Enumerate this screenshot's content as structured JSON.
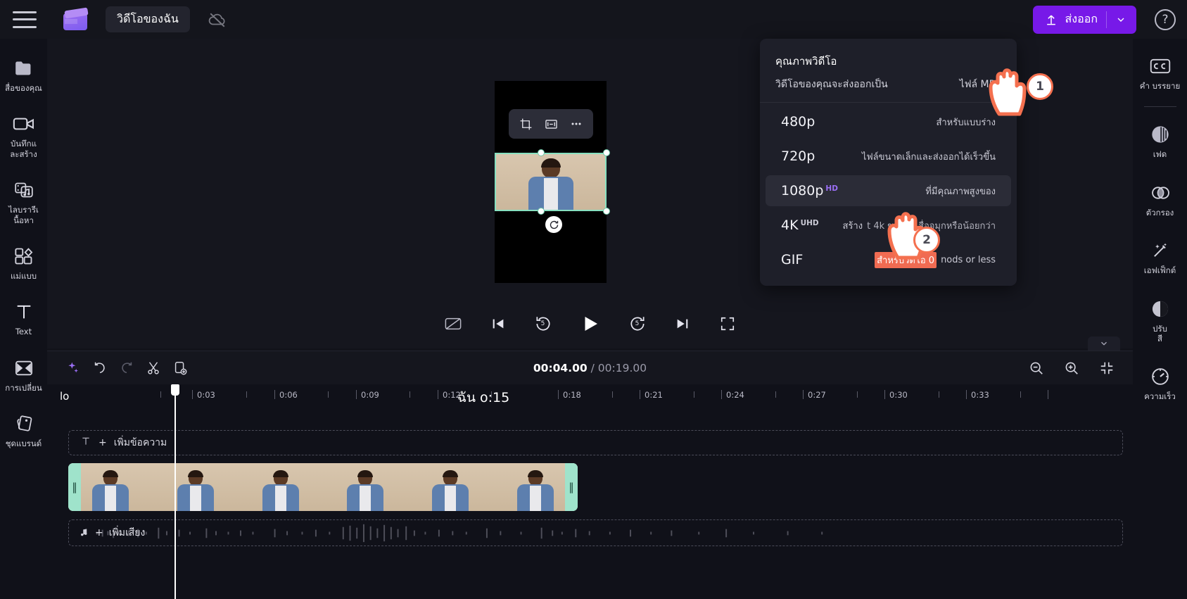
{
  "app": {
    "project_name": "วิดีโอของฉัน",
    "menu_icon": "hamburger-icon",
    "logo_icon": "clapperboard-logo",
    "cloud_icon": "cloud-offline-icon",
    "help_icon": "help-question-icon",
    "export_label": "ส่งออก",
    "export_color": "#7719e8",
    "accent_color": "#9b6ff5",
    "highlight_color": "#f06b52"
  },
  "left_sidebar": {
    "items": [
      {
        "icon": "folder-icon",
        "label": "สื่อของคุณ"
      },
      {
        "icon": "video-camera-icon",
        "label": "บันทึกแ\nละสร้าง"
      },
      {
        "icon": "media-library-icon",
        "label": "ไลบรารีเ\nนื้อหา"
      },
      {
        "icon": "templates-icon",
        "label": "แม่แบบ"
      },
      {
        "icon": "text-icon",
        "label": "Text"
      },
      {
        "icon": "transitions-icon",
        "label": "การเปลี่ยน"
      },
      {
        "icon": "brand-kit-icon",
        "label": "ชุดแบรนด์"
      }
    ]
  },
  "right_sidebar": {
    "items": [
      {
        "icon": "captions-cc-icon",
        "label": "คำ บรรยาย"
      },
      {
        "icon": "fade-icon",
        "label": "เฟด"
      },
      {
        "icon": "filters-icon",
        "label": "ตัวกรอง"
      },
      {
        "icon": "effects-wand-icon",
        "label": "เอฟเฟ็กต์"
      },
      {
        "icon": "adjust-color-icon",
        "label": "ปรับ\nสี"
      },
      {
        "icon": "speed-gauge-icon",
        "label": "ความเร็ว"
      }
    ]
  },
  "preview": {
    "toolbar_icons": [
      "crop-icon",
      "fit-screen-icon",
      "more-options-icon"
    ],
    "rotate_icon": "rotate-icon"
  },
  "playback": {
    "controls": [
      {
        "icon": "captions-off-icon",
        "label": ""
      },
      {
        "icon": "previous-frame-icon",
        "label": ""
      },
      {
        "icon": "rewind-5-icon",
        "label": "5"
      },
      {
        "icon": "play-icon",
        "label": ""
      },
      {
        "icon": "forward-5-icon",
        "label": "5"
      },
      {
        "icon": "next-frame-icon",
        "label": ""
      },
      {
        "icon": "fullscreen-icon",
        "label": ""
      }
    ]
  },
  "timeline": {
    "collapse_icon": "chevron-down-icon",
    "tools": [
      {
        "icon": "magic-sparkle-icon"
      },
      {
        "icon": "undo-icon"
      },
      {
        "icon": "redo-icon"
      },
      {
        "icon": "split-scissors-icon"
      },
      {
        "icon": "duplicate-icon"
      }
    ],
    "current_time": "00:04.00",
    "time_separator": "/",
    "total_time": "00:19.00",
    "right_tools": [
      {
        "icon": "zoom-out-icon"
      },
      {
        "icon": "zoom-in-icon"
      },
      {
        "icon": "fit-timeline-icon"
      }
    ],
    "ruler": {
      "zero_label": "lo",
      "mid_label": "ฉัน o:15",
      "ticks": [
        "0:03",
        "0:06",
        "0:09",
        "0:12",
        "0:18",
        "0:21",
        "0:24",
        "0:27",
        "0:30",
        "0:33"
      ]
    },
    "text_track": {
      "icon": "text-t-icon",
      "plus": "+",
      "label": "เพิ่มข้อความ"
    },
    "audio_track": {
      "icon": "music-note-icon",
      "plus": "+",
      "label": "เพิ่มเสียง"
    },
    "video_clip_color": "#9fe3cb"
  },
  "export_dropdown": {
    "title": "คุณภาพวิดีโอ",
    "format_label": "วิดีโอของคุณจะส่งออกเป็น",
    "format_value": "ไฟล์ MP4",
    "options": [
      {
        "resolution": "480p",
        "tag": "",
        "description": "สำหรับแบบร่าง",
        "active": false,
        "highlight": false
      },
      {
        "resolution": "720p",
        "tag": "",
        "description": "ไฟล์ขนาดเล็กและส่งออกได้เร็วขึ้น",
        "active": false,
        "highlight": false
      },
      {
        "resolution": "1080p",
        "tag": "HD",
        "description": "ที่มีคุณภาพสูงของ",
        "active": true,
        "highlight": false
      },
      {
        "resolution": "4K",
        "tag": "UHD",
        "description": "สร้าง th t 4k ของคุณสื่อจมุกหรือน้อยกว่า",
        "description_prefix": "สร้าง",
        "description_suffix": "t 4k ของคุณสื่อจมุกหรือน้อยกว่า",
        "active": false,
        "highlight": false
      },
      {
        "resolution": "GIF",
        "tag": "",
        "description": "สำหรับวิดีโอ 0",
        "description_suffix": "nods or less",
        "active": false,
        "highlight": true
      }
    ]
  },
  "callouts": [
    {
      "number": "1"
    },
    {
      "number": "2"
    }
  ]
}
